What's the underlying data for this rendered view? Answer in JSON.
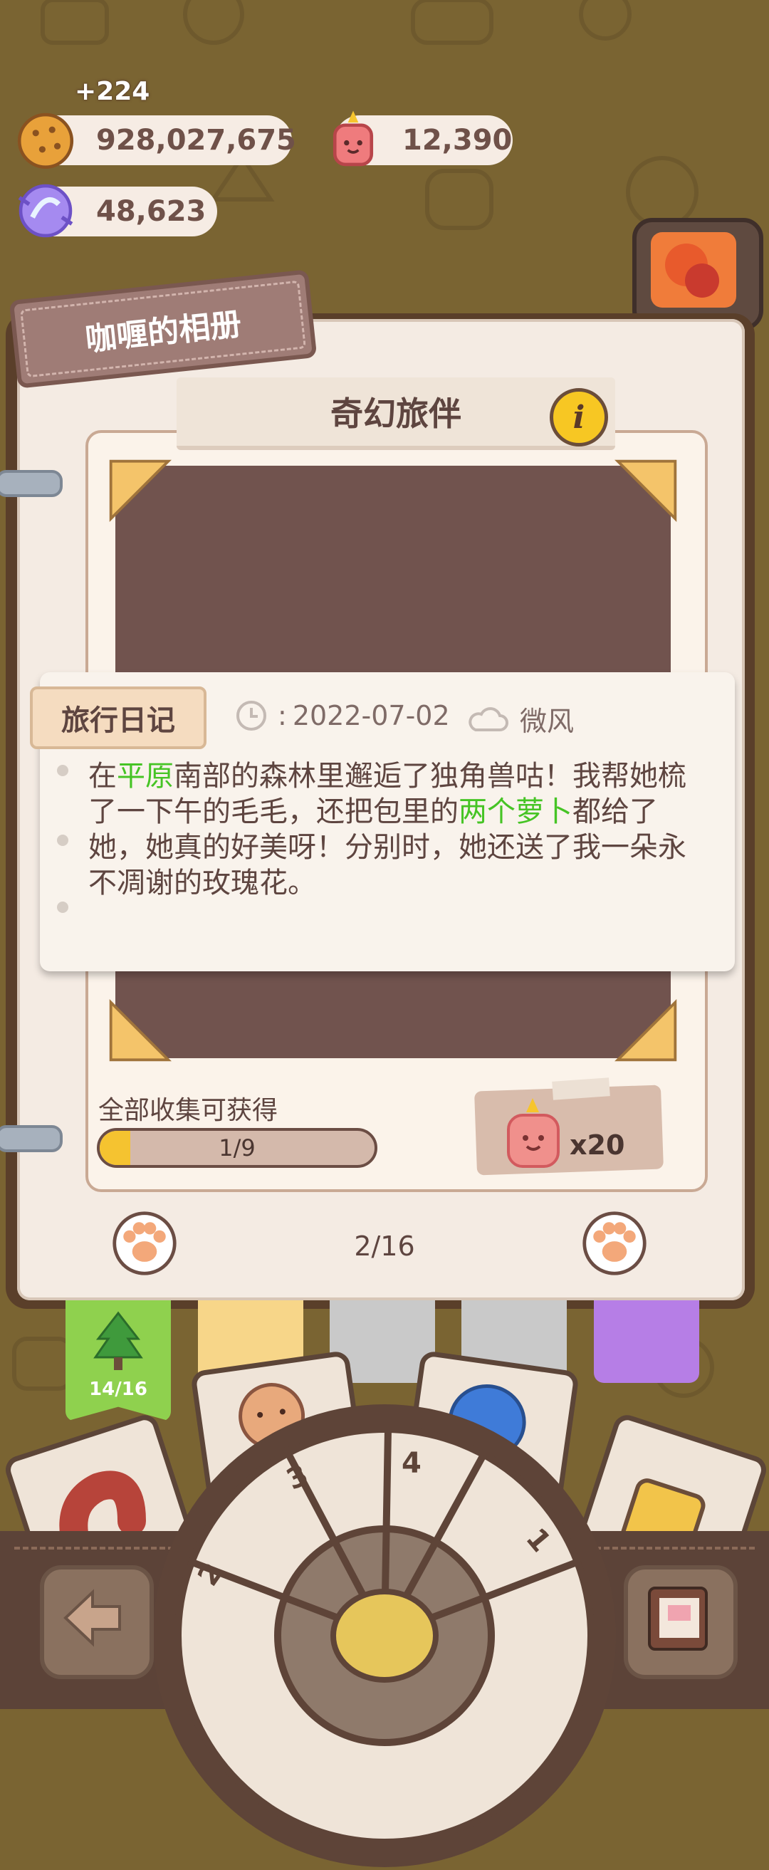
{
  "currency": {
    "cookie": {
      "value": "928,027,675",
      "delta": "+224",
      "icon": "cookie-icon"
    },
    "candle": {
      "value": "12,390",
      "icon": "candle-icon"
    },
    "candy": {
      "value": "48,623",
      "icon": "candy-icon"
    }
  },
  "album": {
    "title": "咖喱的相册",
    "section_title": "奇幻旅伴",
    "info_label": "i"
  },
  "diary": {
    "tab_label": "旅行日记",
    "date": "2022-07-02",
    "weather": "微风",
    "text": {
      "p1": "在",
      "hl1": "平原",
      "p2": "南部的森林里邂逅了独角兽咕！我帮她梳了一下午的毛毛，还把包里的",
      "hl2": "两个萝卜",
      "p3": "都给了她，她真的好美呀！分别时，她还送了我一朵永不凋谢的玫瑰花。"
    }
  },
  "collection": {
    "label": "全部收集可获得",
    "progress_text": "1/9",
    "progress_fraction": 0.111,
    "reward_count": "x20"
  },
  "pagination": {
    "text": "2/16"
  },
  "category_tabs": [
    {
      "name": "tree",
      "label": "14/16",
      "active": true,
      "color": "#8fd14e"
    },
    {
      "name": "yellow",
      "label": "",
      "active": false,
      "color": "#f7d689"
    },
    {
      "name": "gray1",
      "label": "",
      "active": false,
      "color": "#c9c9c9"
    },
    {
      "name": "gray2",
      "label": "",
      "active": false,
      "color": "#c9c9c9"
    },
    {
      "name": "purple",
      "label": "",
      "active": false,
      "color": "#b67ee6"
    }
  ],
  "dial": {
    "segments": [
      "2",
      "3",
      "4",
      "1"
    ]
  },
  "colors": {
    "accent_green": "#46c425",
    "brown_text": "#5e4540",
    "progress_fill": "#f5c330"
  }
}
